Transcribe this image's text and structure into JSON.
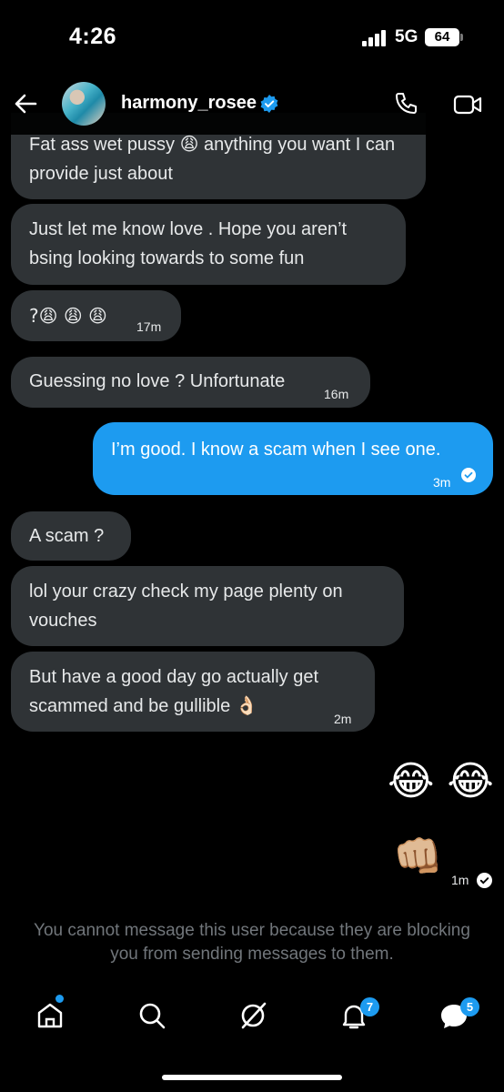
{
  "status": {
    "time": "4:26",
    "network": "5G",
    "battery": "64"
  },
  "header": {
    "name": "harmony_rosee"
  },
  "messages": [
    {
      "text": "Fat ass wet pussy 😩 anything you want I can provide just about"
    },
    {
      "text": "Just let me know love . Hope you aren’t bsing looking towards to some fun"
    },
    {
      "text": "?😩 😩 😩",
      "time": "17m"
    },
    {
      "text": "Guessing no love ? Unfortunate",
      "time": "16m"
    },
    {
      "text": "I’m good. I know a scam when I see one.",
      "time": "3m"
    },
    {
      "text": "A scam ?"
    },
    {
      "text": "lol your crazy check my page plenty on vouches"
    },
    {
      "text": "But have a good day go actually get scammed and be gullible 👌🏻",
      "time": "2m"
    },
    {
      "text": "😂 😂"
    },
    {
      "text": "👊🏼",
      "time": "1m"
    }
  ],
  "notice": "You cannot message this user because they are blocking you from sending messages to them.",
  "nav": {
    "notifications_badge": "7",
    "messages_badge": "5"
  },
  "colors": {
    "accent": "#1d9bf0",
    "received_bubble": "#2f3336",
    "muted_text": "#71767b"
  }
}
